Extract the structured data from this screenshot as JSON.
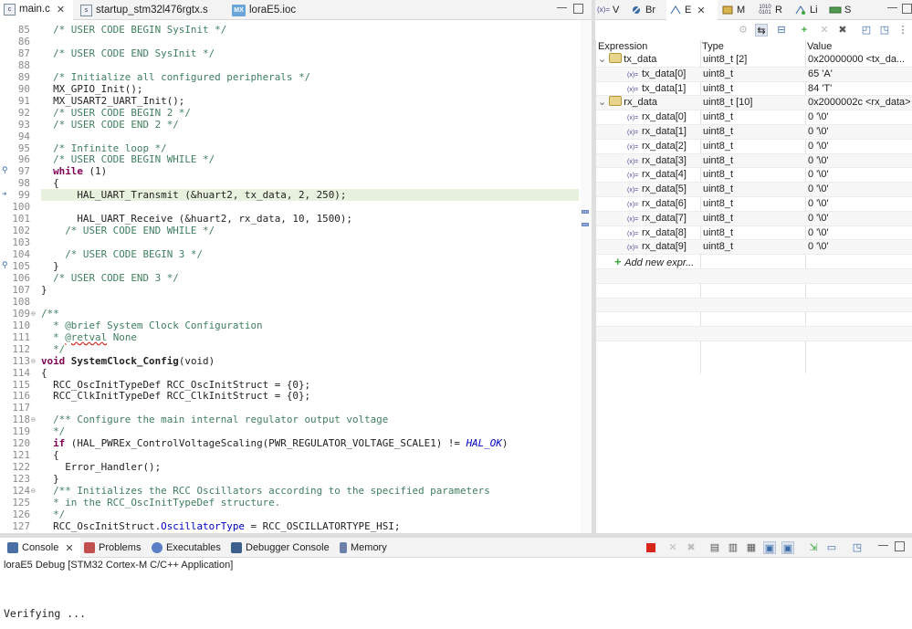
{
  "editor": {
    "tabs": [
      {
        "label": "main.c",
        "icon": "c-file-icon",
        "close": "✕"
      },
      {
        "label": "startup_stm32l476rgtx.s",
        "icon": "asm-file-icon"
      },
      {
        "label": "loraE5.ioc",
        "icon": "MX"
      }
    ],
    "lines": [
      {
        "n": "85",
        "t": "  /* USER CODE BEGIN SysInit */"
      },
      {
        "n": "86",
        "t": ""
      },
      {
        "n": "87",
        "t": "  /* USER CODE END SysInit */"
      },
      {
        "n": "88",
        "t": ""
      },
      {
        "n": "89",
        "t": "  /* Initialize all configured peripherals */"
      },
      {
        "n": "90",
        "t": "  MX_GPIO_Init();"
      },
      {
        "n": "91",
        "t": "  MX_USART2_UART_Init();"
      },
      {
        "n": "92",
        "t": "  /* USER CODE BEGIN 2 */"
      },
      {
        "n": "93",
        "t": "  /* USER CODE END 2 */"
      },
      {
        "n": "94",
        "t": ""
      },
      {
        "n": "95",
        "t": "  /* Infinite loop */"
      },
      {
        "n": "96",
        "t": "  /* USER CODE BEGIN WHILE */"
      },
      {
        "n": "97",
        "t": "  while (1)"
      },
      {
        "n": "98",
        "t": "  {"
      },
      {
        "n": "99",
        "t": "      HAL_UART_Transmit (&huart2, tx_data, 2, 250);"
      },
      {
        "n": "100",
        "t": ""
      },
      {
        "n": "101",
        "t": "      HAL_UART_Receive (&huart2, rx_data, 10, 1500);"
      },
      {
        "n": "102",
        "t": "    /* USER CODE END WHILE */"
      },
      {
        "n": "103",
        "t": ""
      },
      {
        "n": "104",
        "t": "    /* USER CODE BEGIN 3 */"
      },
      {
        "n": "105",
        "t": "  }"
      },
      {
        "n": "106",
        "t": "  /* USER CODE END 3 */"
      },
      {
        "n": "107",
        "t": "}"
      },
      {
        "n": "108",
        "t": ""
      },
      {
        "n": "109",
        "t": "/**"
      },
      {
        "n": "110",
        "t": "  * @brief System Clock Configuration"
      },
      {
        "n": "111",
        "t": "  * @retval None"
      },
      {
        "n": "112",
        "t": "  */"
      },
      {
        "n": "113",
        "t": "void SystemClock_Config(void)"
      },
      {
        "n": "114",
        "t": "{"
      },
      {
        "n": "115",
        "t": "  RCC_OscInitTypeDef RCC_OscInitStruct = {0};"
      },
      {
        "n": "116",
        "t": "  RCC_ClkInitTypeDef RCC_ClkInitStruct = {0};"
      },
      {
        "n": "117",
        "t": ""
      },
      {
        "n": "118",
        "t": "  /** Configure the main internal regulator output voltage"
      },
      {
        "n": "119",
        "t": "  */"
      },
      {
        "n": "120",
        "t": "  if (HAL_PWREx_ControlVoltageScaling(PWR_REGULATOR_VOLTAGE_SCALE1) != HAL_OK)"
      },
      {
        "n": "121",
        "t": "  {"
      },
      {
        "n": "122",
        "t": "    Error_Handler();"
      },
      {
        "n": "123",
        "t": "  }"
      },
      {
        "n": "124",
        "t": "  /** Initializes the RCC Oscillators according to the specified parameters"
      },
      {
        "n": "125",
        "t": "  * in the RCC_OscInitTypeDef structure."
      },
      {
        "n": "126",
        "t": "  */"
      },
      {
        "n": "127",
        "t": "  RCC_OscInitStruct.OscillatorType = RCC_OSCILLATORTYPE_HSI;"
      }
    ]
  },
  "right_panel": {
    "tabs": [
      {
        "label": "V",
        "icon": "(x)="
      },
      {
        "label": "Br",
        "icon": "breakpoints-icon"
      },
      {
        "label": "E",
        "icon": "expressions-icon",
        "close": "✕"
      },
      {
        "label": "M",
        "icon": "modules-icon"
      },
      {
        "label": "R",
        "icon": "1010 0101"
      },
      {
        "label": "Li",
        "icon": "live-expressions-icon"
      },
      {
        "label": "S",
        "icon": "sfr-icon"
      }
    ],
    "columns": {
      "expression": "Expression",
      "type": "Type",
      "value": "Value"
    },
    "rows": [
      {
        "expr": "tx_data",
        "type": "uint8_t [2]",
        "value": "0x20000000 <tx_da...",
        "level": 0,
        "expanded": true
      },
      {
        "expr": "tx_data[0]",
        "type": "uint8_t",
        "value": "65 'A'",
        "level": 1
      },
      {
        "expr": "tx_data[1]",
        "type": "uint8_t",
        "value": "84 'T'",
        "level": 1
      },
      {
        "expr": "rx_data",
        "type": "uint8_t [10]",
        "value": "0x2000002c <rx_data>",
        "level": 0,
        "expanded": true
      },
      {
        "expr": "rx_data[0]",
        "type": "uint8_t",
        "value": "0 '\\0'",
        "level": 1
      },
      {
        "expr": "rx_data[1]",
        "type": "uint8_t",
        "value": "0 '\\0'",
        "level": 1
      },
      {
        "expr": "rx_data[2]",
        "type": "uint8_t",
        "value": "0 '\\0'",
        "level": 1
      },
      {
        "expr": "rx_data[3]",
        "type": "uint8_t",
        "value": "0 '\\0'",
        "level": 1
      },
      {
        "expr": "rx_data[4]",
        "type": "uint8_t",
        "value": "0 '\\0'",
        "level": 1
      },
      {
        "expr": "rx_data[5]",
        "type": "uint8_t",
        "value": "0 '\\0'",
        "level": 1
      },
      {
        "expr": "rx_data[6]",
        "type": "uint8_t",
        "value": "0 '\\0'",
        "level": 1
      },
      {
        "expr": "rx_data[7]",
        "type": "uint8_t",
        "value": "0 '\\0'",
        "level": 1
      },
      {
        "expr": "rx_data[8]",
        "type": "uint8_t",
        "value": "0 '\\0'",
        "level": 1
      },
      {
        "expr": "rx_data[9]",
        "type": "uint8_t",
        "value": "0 '\\0'",
        "level": 1
      }
    ],
    "add_new": "Add new expr...",
    "child_icon": "(x)="
  },
  "console": {
    "tabs": [
      {
        "label": "Console",
        "close": "✕",
        "color": "#4a6fa5"
      },
      {
        "label": "Problems",
        "color": "#c0504d"
      },
      {
        "label": "Executables",
        "color": "#5b7fc7"
      },
      {
        "label": "Debugger Console",
        "color": "#3b5f8a"
      },
      {
        "label": "Memory",
        "color": "#6b7fa8"
      }
    ],
    "session": "loraE5 Debug [STM32 Cortex-M C/C++ Application]",
    "output": "Verifying ..."
  },
  "colors": {
    "highlight": "#e8f0de",
    "comment": "#3f7f5f",
    "keyword": "#7f0055",
    "field": "#0000c0",
    "terminate": "#d9261c"
  }
}
